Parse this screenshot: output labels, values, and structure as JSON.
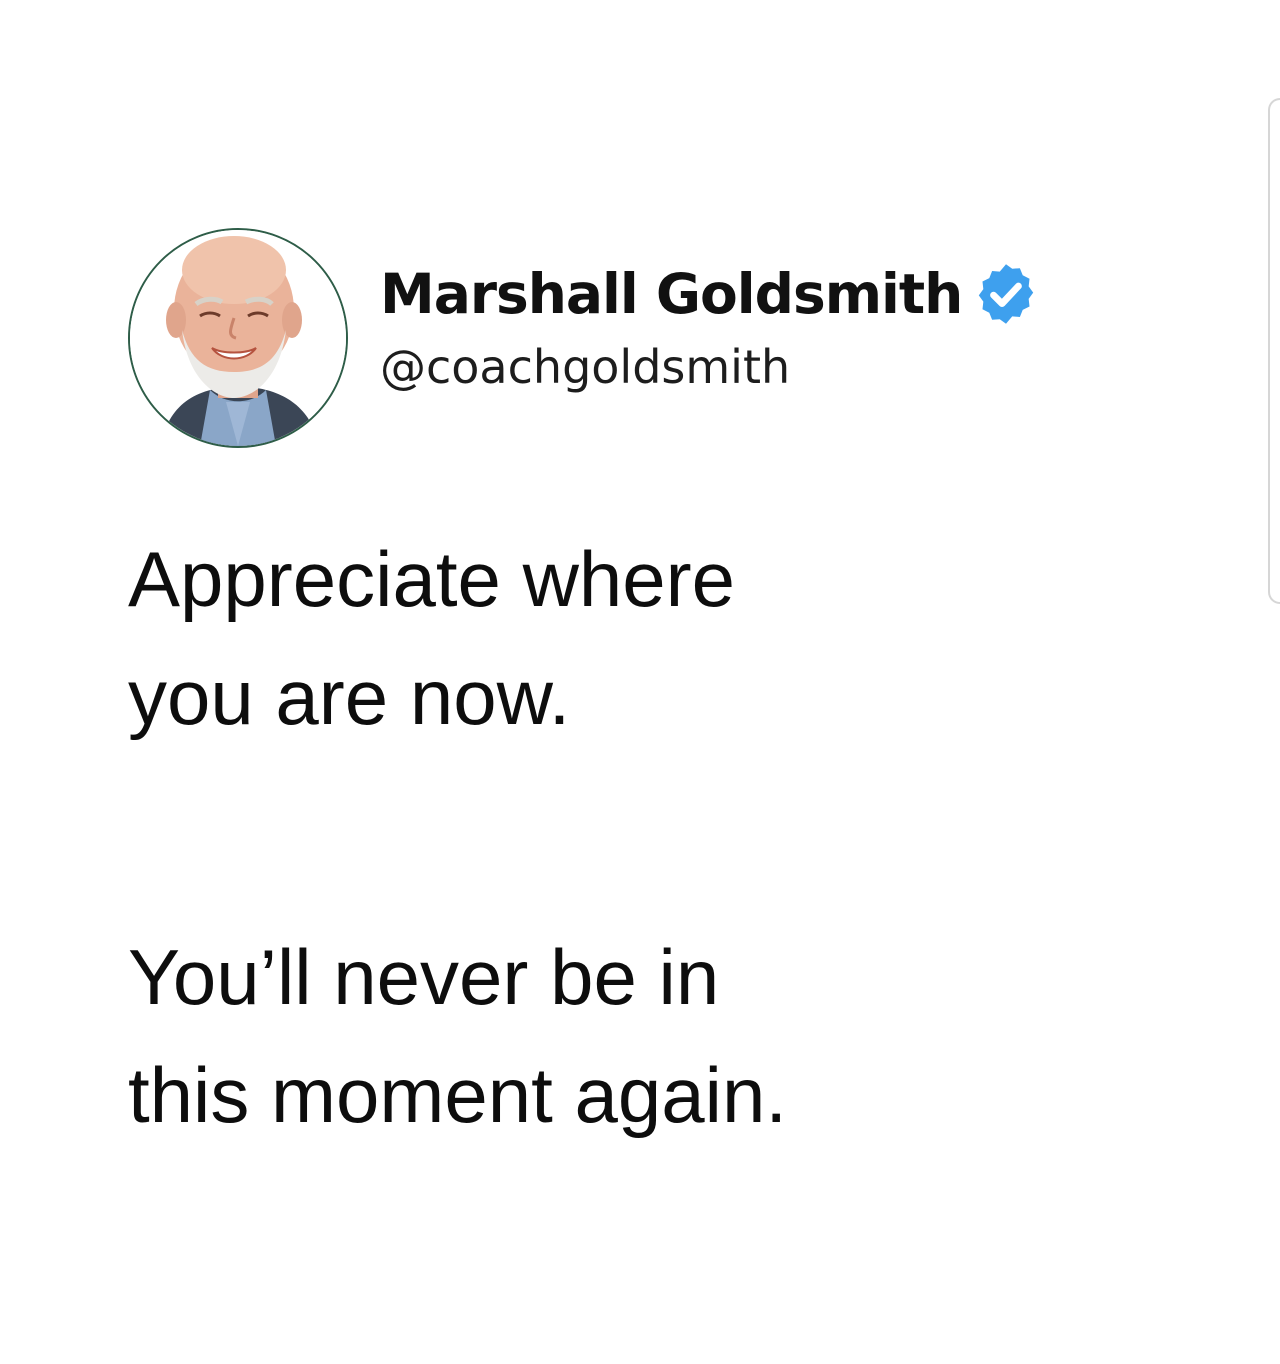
{
  "tweet": {
    "author": {
      "display_name": "Marshall Goldsmith",
      "handle": "@coachgoldsmith",
      "verified": true,
      "verified_color": "#3ea0ee",
      "avatar_ring_color": "#2e5d48"
    },
    "paragraphs": [
      [
        "Appreciate where",
        "you are now."
      ],
      [
        "You’ll never be in",
        "this moment again."
      ]
    ]
  },
  "icons": {
    "verified": "verified-badge-icon",
    "avatar": "profile-photo"
  }
}
